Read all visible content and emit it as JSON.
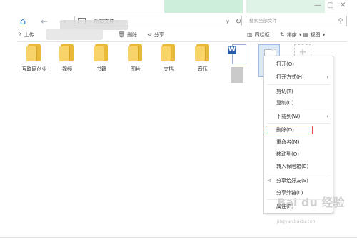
{
  "address_bar": {
    "path_root_label": "所有文件",
    "search_placeholder": "搜索全部文件"
  },
  "toolbar": {
    "upload": "上传",
    "delete": "删除",
    "share": "分享",
    "view_columns": "四栏柜",
    "sort": "排序",
    "view": "视图"
  },
  "files": [
    {
      "name": "互联网创业",
      "type": "folder"
    },
    {
      "name": "视频",
      "type": "folder"
    },
    {
      "name": "书籍",
      "type": "folder"
    },
    {
      "name": "图片",
      "type": "folder"
    },
    {
      "name": "文档",
      "type": "folder"
    },
    {
      "name": "音乐",
      "type": "folder"
    },
    {
      "name": "",
      "type": "word"
    },
    {
      "name": "",
      "type": "file-selected"
    },
    {
      "name": "",
      "type": "new"
    }
  ],
  "context_menu": {
    "items": [
      {
        "label": "打开(O)",
        "submenu": false
      },
      {
        "label": "打开方式(H)",
        "submenu": true
      },
      {
        "label": "剪切(T)",
        "submenu": false
      },
      {
        "label": "复制(C)",
        "submenu": false
      },
      {
        "label": "下载到(W)",
        "submenu": true
      },
      {
        "label": "删除(D)",
        "submenu": false,
        "highlighted": true
      },
      {
        "label": "重命名(M)",
        "submenu": false
      },
      {
        "label": "移动到(Q)",
        "submenu": false
      },
      {
        "label": "转入保险箱(B)",
        "submenu": false
      },
      {
        "label": "分享给好友(S)",
        "submenu": false
      },
      {
        "label": "分享外链(L)",
        "submenu": false
      },
      {
        "label": "属性(R)",
        "submenu": false
      }
    ]
  },
  "watermark": {
    "text": "Bai du 经验",
    "sub": "jingyan.baidu.com"
  },
  "colors": {
    "accent": "#2a73d6",
    "folder": "#f7d36a",
    "highlight_border": "#e05252"
  }
}
